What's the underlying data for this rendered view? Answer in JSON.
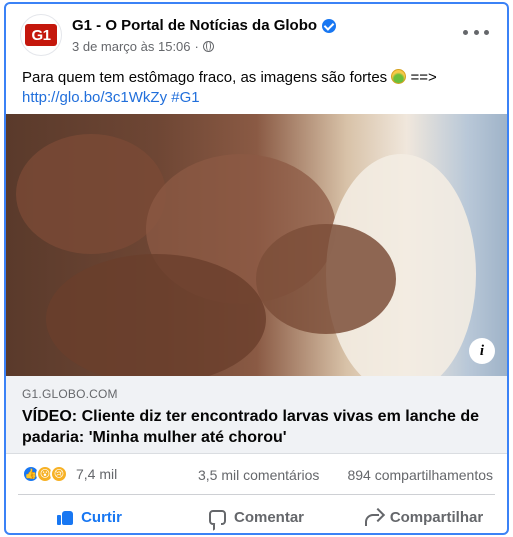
{
  "post": {
    "page_name": "G1 - O Portal de Notícias da Globo",
    "avatar_text": "G1",
    "timestamp": "3 de março às 15:06",
    "separator": "·",
    "text_line": "Para quem tem estômago fraco, as imagens são fortes",
    "text_arrow": "==>",
    "link": "http://glo.bo/3c1WkZy",
    "hashtag": "#G1"
  },
  "preview": {
    "domain": "G1.GLOBO.COM",
    "headline": "VÍDEO: Cliente diz ter encontrado larvas vivas em lanche de padaria: 'Minha mulher até chorou'",
    "info_icon_glyph": "i"
  },
  "stats": {
    "reactions_count": "7,4 mil",
    "comments": "3,5 mil comentários",
    "shares": "894 compartilhamentos"
  },
  "actions": {
    "like": "Curtir",
    "comment": "Comentar",
    "share": "Compartilhar"
  },
  "colors": {
    "border_focus": "#3b82f6",
    "link": "#216fdb",
    "brand_g1": "#c4170c",
    "like_blue": "#1877f2",
    "muted": "#65676b"
  },
  "icons": [
    "verified-badge-icon",
    "globe-icon",
    "more-options-icon",
    "info-icon",
    "like-reaction-icon",
    "wow-reaction-icon",
    "sad-reaction-icon",
    "like-thumb-icon",
    "comment-icon",
    "share-icon"
  ]
}
